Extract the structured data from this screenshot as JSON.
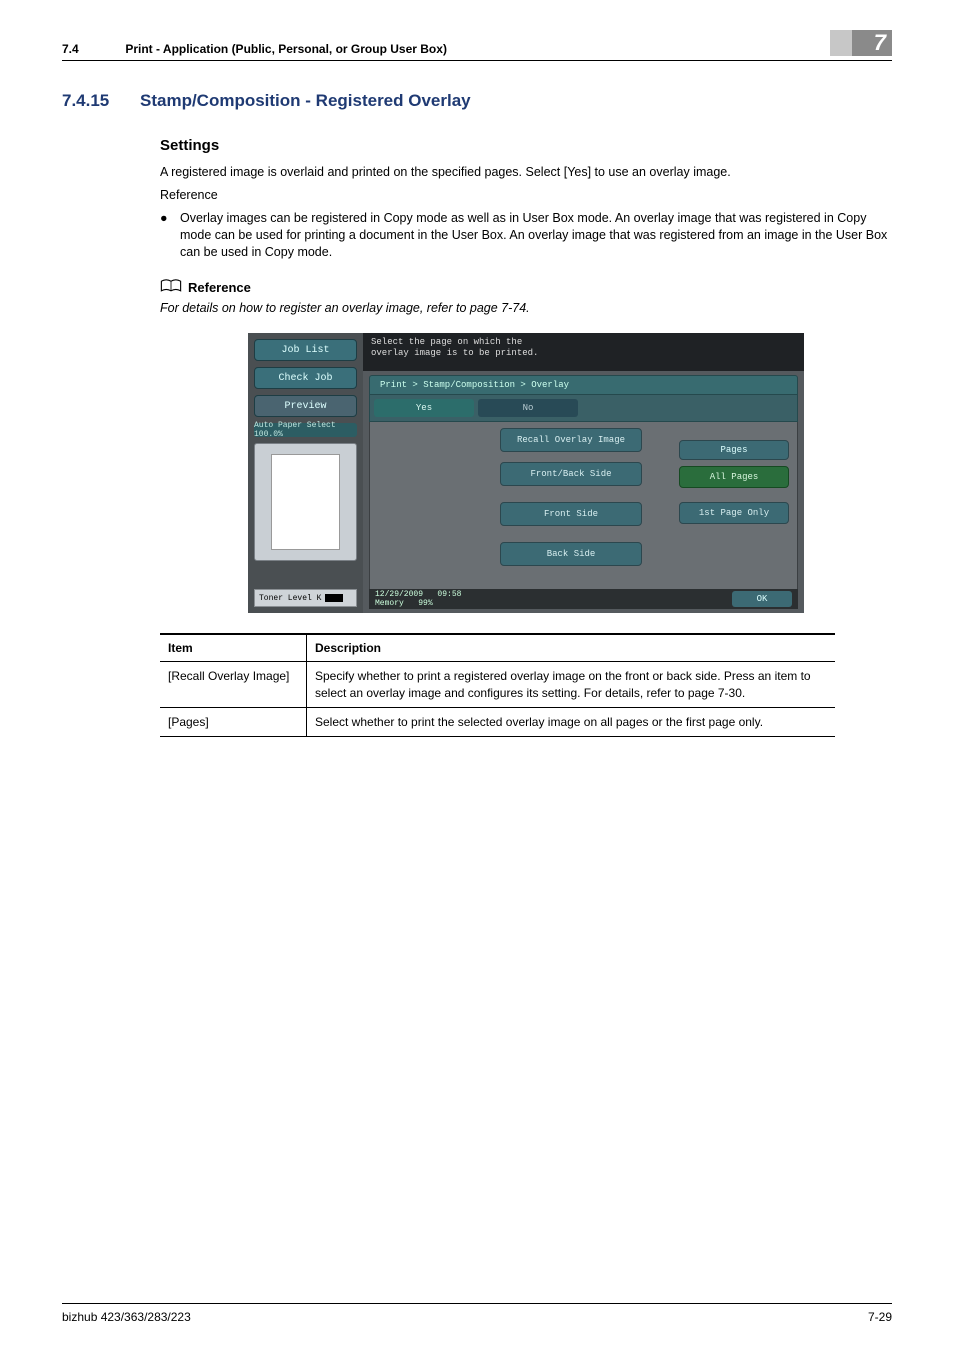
{
  "header": {
    "section_num": "7.4",
    "section_title": "Print - Application (Public, Personal, or Group User Box)",
    "chapter_badge": "7"
  },
  "heading": {
    "num": "7.4.15",
    "title": "Stamp/Composition - Registered Overlay"
  },
  "settings": {
    "title": "Settings",
    "para1": "A registered image is overlaid and printed on the specified pages. Select [Yes] to use an overlay image.",
    "ref_label": "Reference",
    "bullet1": "Overlay images can be registered in Copy mode as well as in User Box mode. An overlay image that was registered in Copy mode can be used for printing a document in the User Box. An overlay image that was registered from an image in the User Box can be used in Copy mode."
  },
  "reference": {
    "title": "Reference",
    "text": "For details on how to register an overlay image, refer to page 7-74."
  },
  "screenshot": {
    "left": {
      "job_list": "Job List",
      "check_job": "Check Job",
      "preview": "Preview",
      "zoom": "Auto Paper Select  100.0%",
      "toner": "Toner Level  K"
    },
    "instr1": "Select the page on which the",
    "instr2": "overlay image is to be printed.",
    "path": "Print > Stamp/Composition > Overlay",
    "yes": "Yes",
    "no": "No",
    "recall": "Recall Overlay Image",
    "front_back": "Front/Back Side",
    "front": "Front Side",
    "back": "Back Side",
    "pages_head": "Pages",
    "all_pages": "All Pages",
    "first_only": "1st Page Only",
    "date": "12/29/2009",
    "time": "09:58",
    "mem_label": "Memory",
    "mem_val": "99%",
    "ok": "OK"
  },
  "table": {
    "h1": "Item",
    "h2": "Description",
    "rows": [
      {
        "item": "[Recall Overlay Image]",
        "desc": "Specify whether to print a registered overlay image on the front or back side. Press an item to select an overlay image and configures its setting. For details, refer to page 7-30."
      },
      {
        "item": "[Pages]",
        "desc": "Select whether to print the selected overlay image on all pages or the first page only."
      }
    ]
  },
  "footer": {
    "model": "bizhub 423/363/283/223",
    "page": "7-29"
  }
}
